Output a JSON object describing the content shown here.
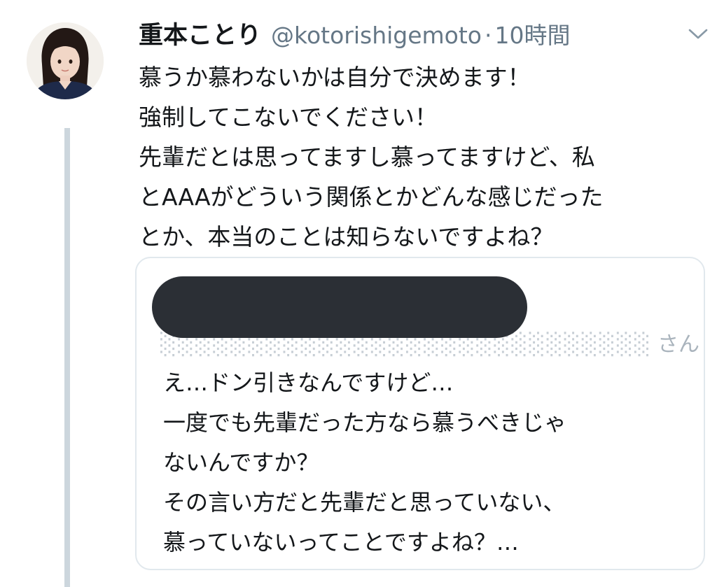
{
  "tweet": {
    "name": "重本ことり",
    "handle": "@kotorishigemoto",
    "separator": "·",
    "time": "10時間",
    "text_lines": [
      "慕うか慕わないかは自分で決めます！",
      "強制してこないでください！",
      "先輩だとは思ってますし慕ってますけど、私",
      "とAAAがどういう関係とかどんな感じだった",
      "とか、本当のことは知らないですよね？"
    ],
    "avatar_icon": "avatar-photo",
    "menu_icon": "chevron-down-icon"
  },
  "quoted": {
    "header_visible": "さん",
    "redaction_color": "#2b2f35",
    "text_lines": [
      "え…ドン引きなんですけど…",
      "一度でも先輩だった方なら慕うべきじゃ",
      "ないんですか？",
      "その言い方だと先輩だと思っていない、",
      "慕っていないってことですよね？…"
    ]
  },
  "colors": {
    "name": "#14171a",
    "secondary": "#657786",
    "thread_line": "#ccd6dd",
    "border": "#e1e8ed"
  }
}
